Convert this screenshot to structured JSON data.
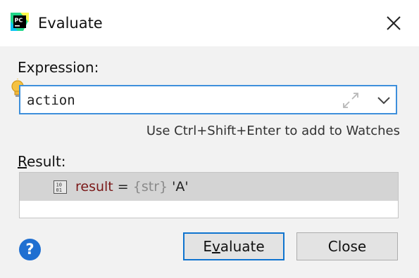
{
  "window": {
    "title": "Evaluate",
    "app_icon": "pycharm-logo-icon",
    "app_icon_text": "PC",
    "close_icon": "close-icon"
  },
  "expression": {
    "label": "Expression:",
    "value": "action",
    "hint": "Use Ctrl+Shift+Enter to add to Watches",
    "hint_icon": "lightbulb-icon",
    "expand_icon": "expand-icon",
    "history_icon": "chevron-down-icon"
  },
  "result": {
    "label_first": "R",
    "label_rest": "esult:",
    "rows": [
      {
        "icon": "variable-binary-icon",
        "name": "result",
        "eq": " = ",
        "type": "{str}",
        "value": " 'A'"
      }
    ]
  },
  "footer": {
    "help_label": "?",
    "evaluate_pre": "E",
    "evaluate_mnemonic": "v",
    "evaluate_post": "aluate",
    "close_label": "Close"
  },
  "colors": {
    "accent": "#3d8fdb",
    "primary_border": "#0f74cf",
    "result_row_bg": "#d4d4d4",
    "variable_name": "#7a1818",
    "type_text": "#8a8a8a",
    "help_bg": "#1f6fd1"
  }
}
